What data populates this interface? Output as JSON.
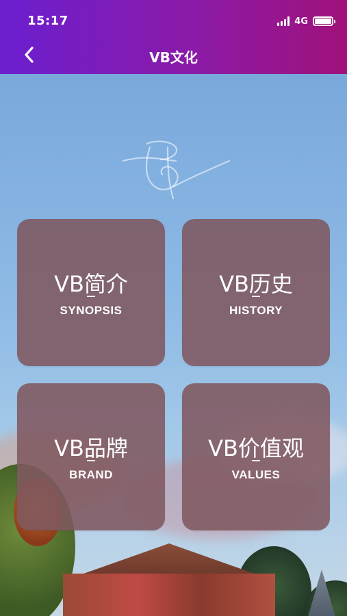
{
  "status_bar": {
    "time": "15:17",
    "network": "4G"
  },
  "nav": {
    "title": "VB文化"
  },
  "tiles": [
    {
      "cn": "VB简介",
      "en": "SYNOPSIS"
    },
    {
      "cn": "VB历史",
      "en": "HISTORY"
    },
    {
      "cn": "VB品牌",
      "en": "BRAND"
    },
    {
      "cn": "VB价值观",
      "en": "VALUES"
    }
  ],
  "icons": [
    "back-chevron-icon",
    "signal-icon",
    "battery-icon",
    "vb-logo"
  ],
  "colors": {
    "header_start": "#6b1fd0",
    "header_end": "#a0127a",
    "tile_bg": "#805860"
  }
}
